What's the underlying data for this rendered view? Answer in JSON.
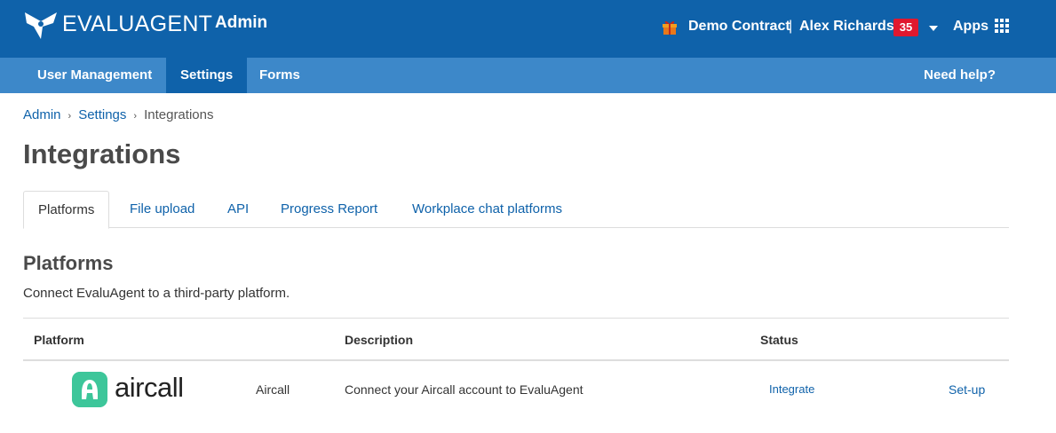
{
  "header": {
    "brand": "EVALUAGENT",
    "section": "Admin",
    "contract": "Demo Contract",
    "separator": "|",
    "user": "Alex Richards",
    "notification_count": "35",
    "apps_label": "Apps"
  },
  "subnav": {
    "items": [
      {
        "label": "User Management"
      },
      {
        "label": "Settings",
        "active": true
      },
      {
        "label": "Forms"
      }
    ],
    "help": "Need help?"
  },
  "breadcrumb": {
    "items": [
      "Admin",
      "Settings",
      "Integrations"
    ],
    "chevron": "›"
  },
  "page_title": "Integrations",
  "tabs": [
    {
      "label": "Platforms",
      "active": true
    },
    {
      "label": "File upload"
    },
    {
      "label": "API"
    },
    {
      "label": "Progress Report"
    },
    {
      "label": "Workplace chat platforms"
    }
  ],
  "section": {
    "title": "Platforms",
    "description": "Connect EvaluAgent to a third-party platform."
  },
  "table": {
    "headers": [
      "Platform",
      "Description",
      "Status"
    ],
    "rows": [
      {
        "logo_text": "aircall",
        "name": "Aircall",
        "description": "Connect your Aircall account to EvaluAgent",
        "status": "Integrate",
        "action": "Set-up"
      }
    ]
  },
  "colors": {
    "header_bg": "#0f62aa",
    "subnav_bg": "#3d88c9",
    "badge": "#e0182e",
    "link": "#0f62aa",
    "aircall_green": "#3dc69a"
  },
  "icons": [
    "evaluagent-logo-icon",
    "gift-icon",
    "chevron-down-icon",
    "apps-grid-icon",
    "aircall-logo-icon"
  ]
}
